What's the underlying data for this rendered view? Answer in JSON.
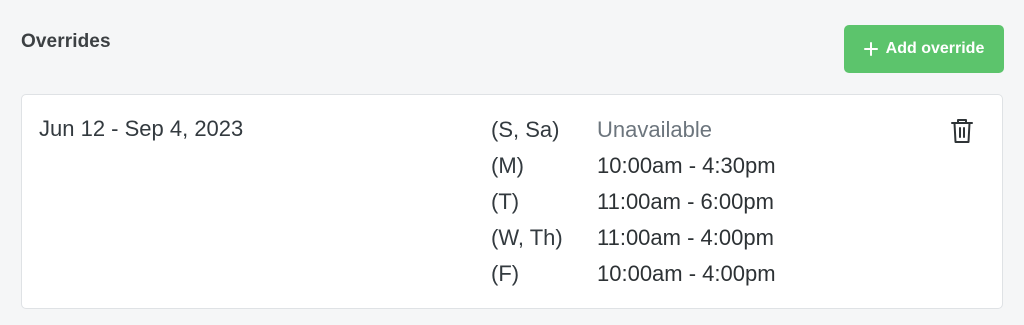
{
  "section": {
    "title": "Overrides"
  },
  "add_button": {
    "label": "Add override",
    "icon": "plus-icon",
    "color": "#5cc46c"
  },
  "override": {
    "date_range": "Jun 12 - Sep 4, 2023",
    "schedule": [
      {
        "days": "(S, Sa)",
        "hours": "Unavailable",
        "unavailable": true
      },
      {
        "days": "(M)",
        "hours": "10:00am - 4:30pm",
        "unavailable": false
      },
      {
        "days": "(T)",
        "hours": "11:00am - 6:00pm",
        "unavailable": false
      },
      {
        "days": "(W, Th)",
        "hours": "11:00am - 4:00pm",
        "unavailable": false
      },
      {
        "days": "(F)",
        "hours": "10:00am - 4:00pm",
        "unavailable": false
      }
    ],
    "delete_icon": "trash-icon"
  }
}
